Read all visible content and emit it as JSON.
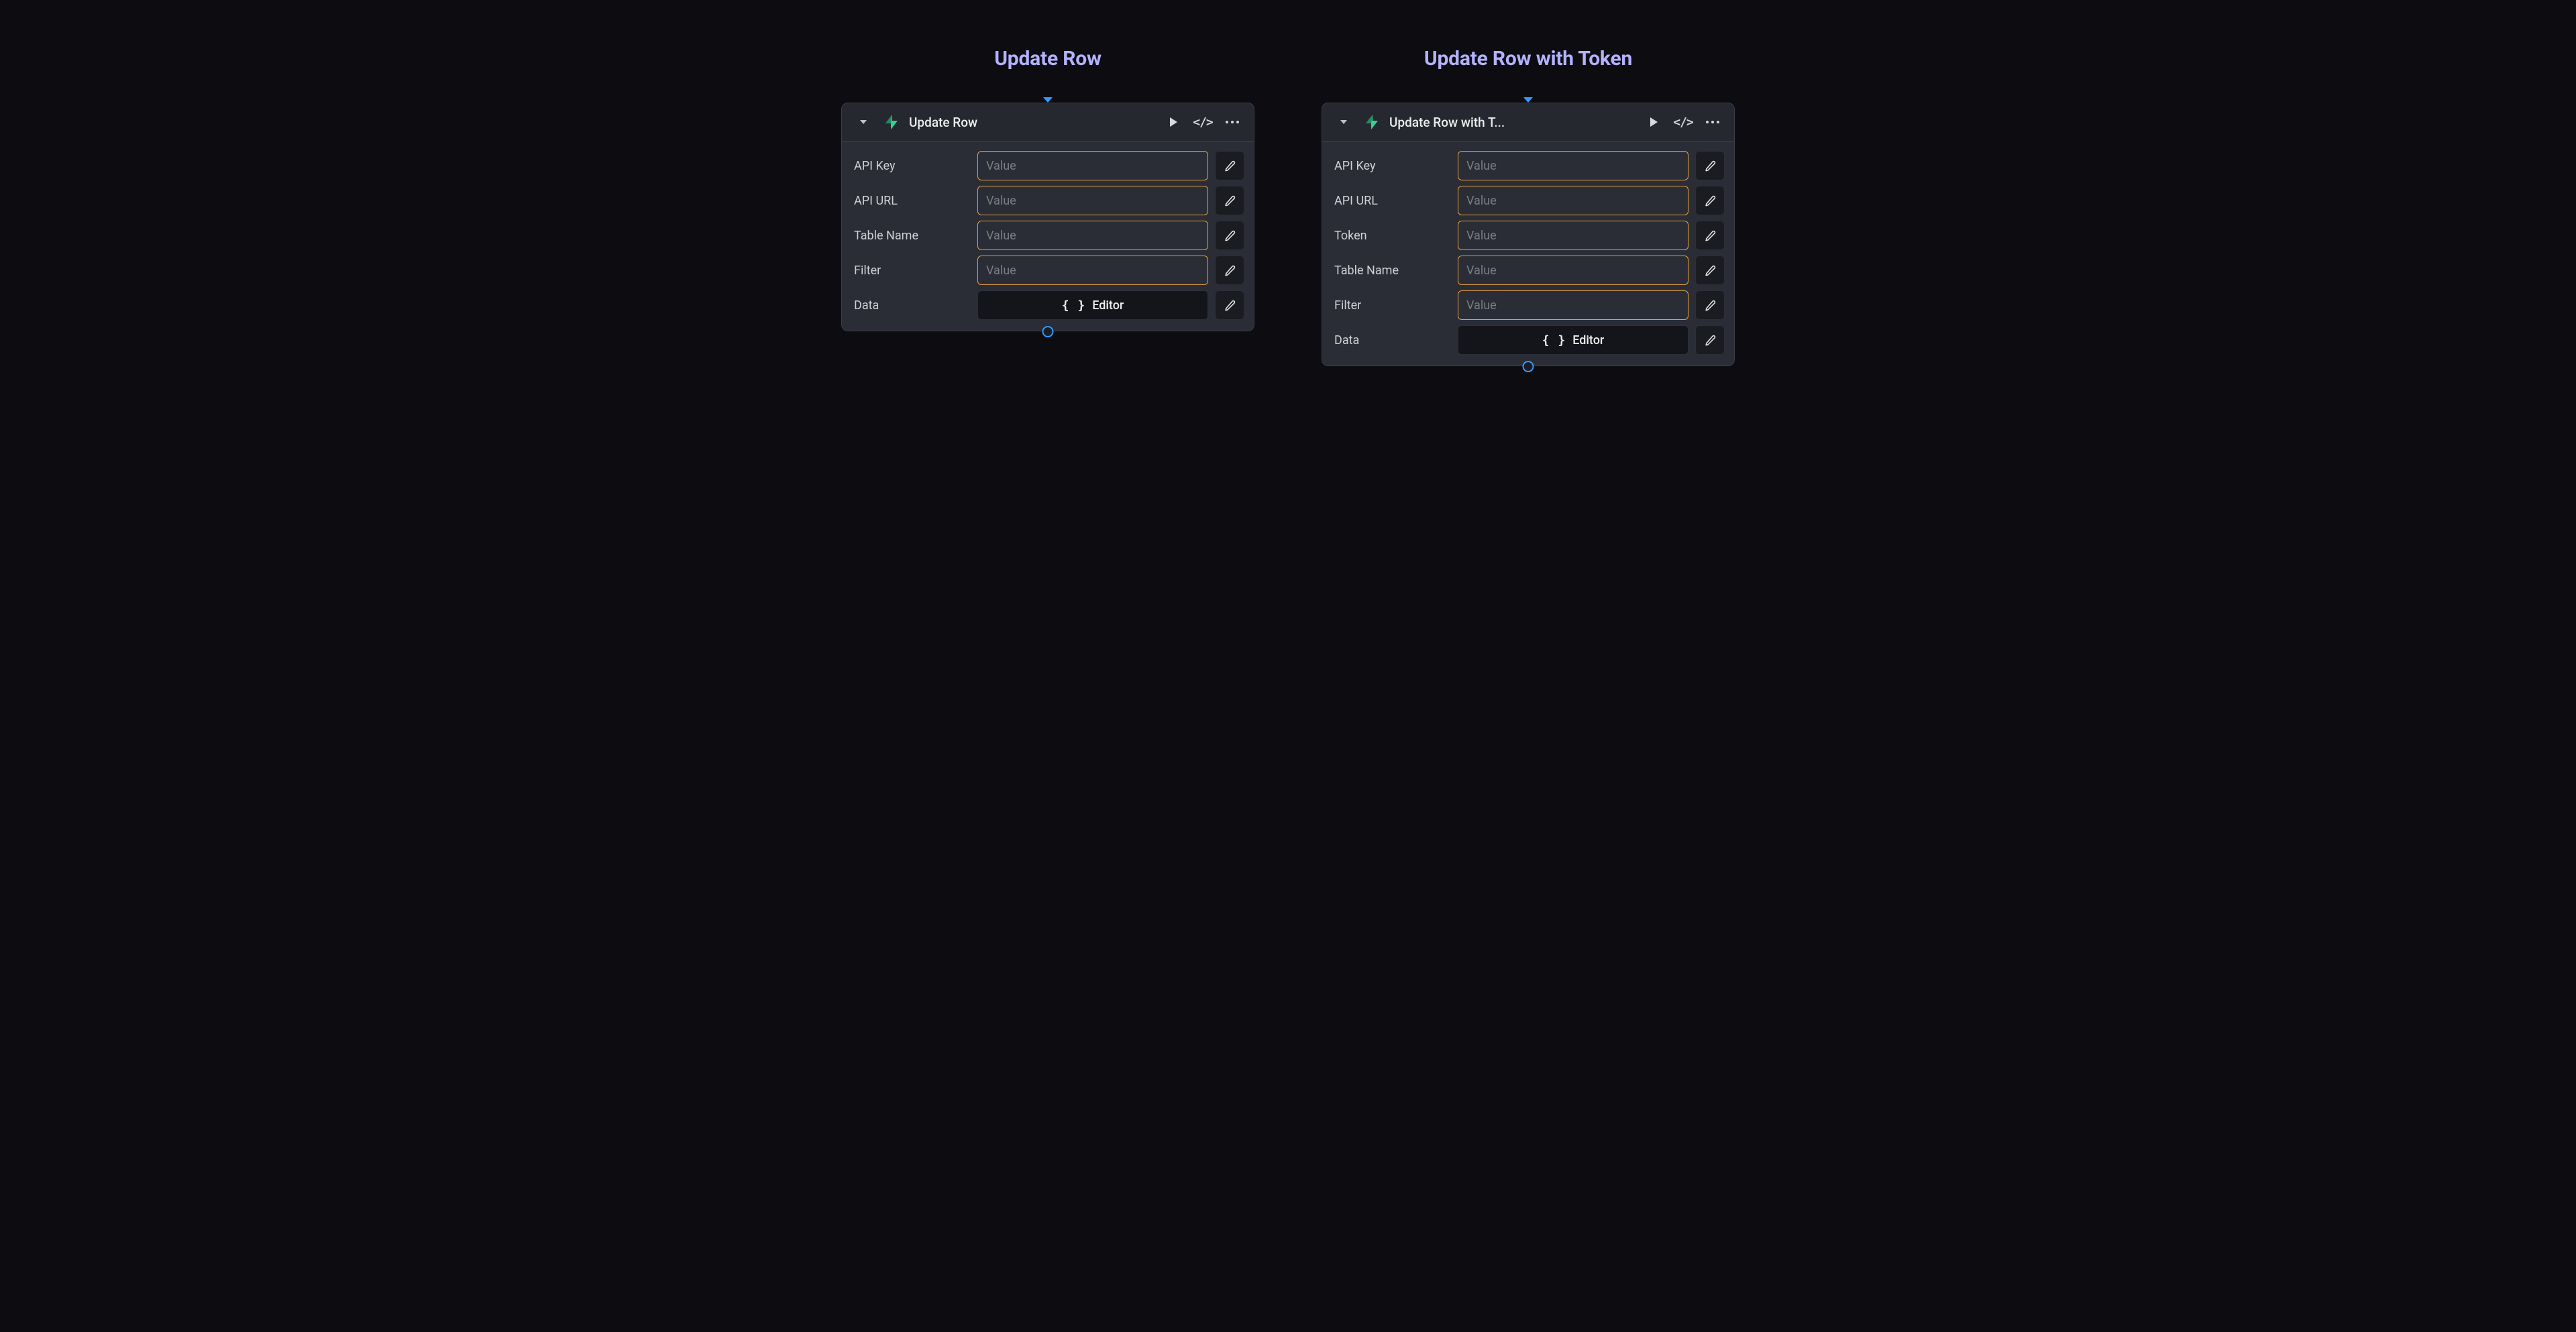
{
  "colors": {
    "accent_title": "#b3b2ff",
    "input_border": "#e9a23b",
    "port_blue": "#2e9dff",
    "logo_green_a": "#3ecf8f",
    "logo_green_b": "#1d8e62"
  },
  "panels": [
    {
      "heading": "Update Row",
      "node_title": "Update Row",
      "fields": [
        {
          "label": "API Key",
          "kind": "value",
          "placeholder": "Value"
        },
        {
          "label": "API URL",
          "kind": "value",
          "placeholder": "Value"
        },
        {
          "label": "Table Name",
          "kind": "value",
          "placeholder": "Value"
        },
        {
          "label": "Filter",
          "kind": "value",
          "placeholder": "Value"
        },
        {
          "label": "Data",
          "kind": "editor",
          "button_text": "Editor"
        }
      ]
    },
    {
      "heading": "Update Row with Token",
      "node_title": "Update Row with T...",
      "fields": [
        {
          "label": "API Key",
          "kind": "value",
          "placeholder": "Value"
        },
        {
          "label": "API URL",
          "kind": "value",
          "placeholder": "Value"
        },
        {
          "label": "Token",
          "kind": "value",
          "placeholder": "Value"
        },
        {
          "label": "Table Name",
          "kind": "value",
          "placeholder": "Value"
        },
        {
          "label": "Filter",
          "kind": "value",
          "placeholder": "Value"
        },
        {
          "label": "Data",
          "kind": "editor",
          "button_text": "Editor"
        }
      ]
    }
  ]
}
